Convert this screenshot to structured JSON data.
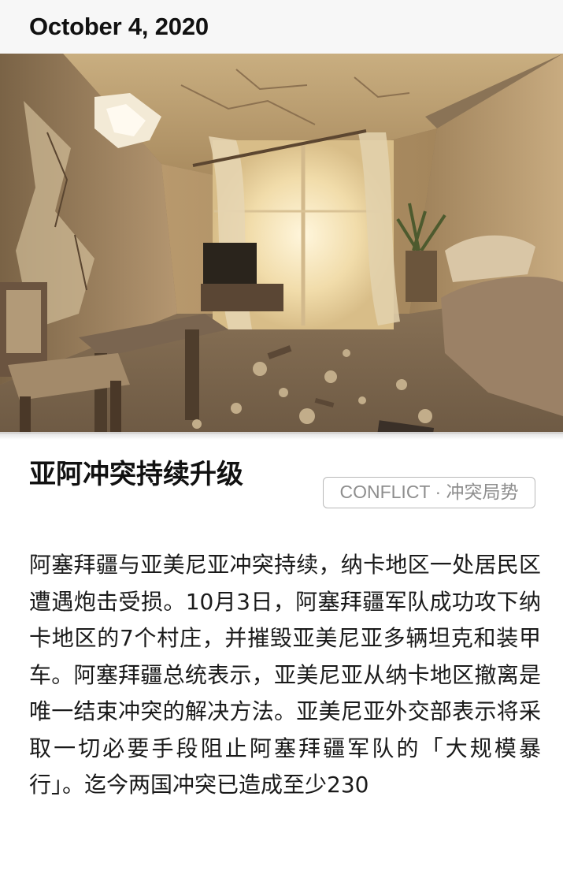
{
  "article": {
    "date": "October 4, 2020",
    "image_description_icon": "war-damaged-room-photo",
    "title": "亚阿冲突持续升级",
    "tag": "CONFLICT · 冲突局势",
    "body": "阿塞拜疆与亚美尼亚冲突持续，纳卡地区一处居民区遭遇炮击受损。10月3日，阿塞拜疆军队成功攻下纳卡地区的7个村庄，并摧毁亚美尼亚多辆坦克和装甲车。阿塞拜疆总统表示，亚美尼亚从纳卡地区撤离是唯一结束冲突的解决方法。亚美尼亚外交部表示将采取一切必要手段阻止阿塞拜疆军队的「大规模暴行」。迄今两国冲突已造成至少230"
  },
  "colors": {
    "date_bar_bg": "#f7f7f7",
    "text": "#111111",
    "tag_border": "#b9b9b9",
    "tag_text": "#8e8e8e"
  }
}
